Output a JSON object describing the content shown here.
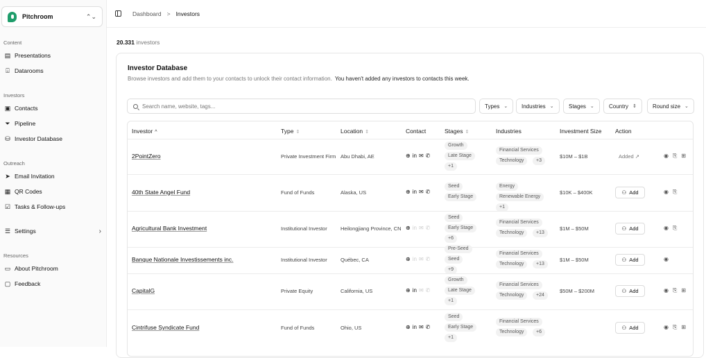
{
  "workspace": {
    "name": "Pitchroom",
    "chevron": "⌃⌄"
  },
  "sidebar": {
    "sections": [
      {
        "label": "Content"
      },
      {
        "label": "Investors"
      },
      {
        "label": "Outreach"
      },
      {
        "label": "Resources"
      }
    ],
    "items": [
      {
        "label": "Presentations",
        "icon": "file-icon"
      },
      {
        "label": "Datarooms",
        "icon": "folder-icon"
      },
      {
        "label": "Contacts",
        "icon": "contact-card-icon"
      },
      {
        "label": "Pipeline",
        "icon": "filter-icon"
      },
      {
        "label": "Investor Database",
        "icon": "database-icon"
      },
      {
        "label": "Email Invitation",
        "icon": "send-icon"
      },
      {
        "label": "QR Codes",
        "icon": "qr-icon"
      },
      {
        "label": "Tasks & Follow-ups",
        "icon": "checkbox-icon"
      },
      {
        "label": "Settings",
        "icon": "sliders-icon",
        "arrow": "›"
      },
      {
        "label": "About Pitchroom",
        "icon": "book-icon"
      },
      {
        "label": "Feedback",
        "icon": "message-icon"
      }
    ]
  },
  "breadcrumb": {
    "root": "Dashboard",
    "sep": ">",
    "current": "Investors"
  },
  "summary": {
    "count": "20.331",
    "suffix": "investors"
  },
  "card": {
    "title": "Investor Database",
    "subtitle": "Browse investors and add them to your contacts to unlock their contact information.",
    "notice": "You haven't added any investors to contacts this week."
  },
  "search": {
    "placeholder": "Search name, website, tags..."
  },
  "filters": [
    {
      "label": "Types",
      "chev": "⌄"
    },
    {
      "label": "Industries",
      "chev": "⌄"
    },
    {
      "label": "Stages",
      "chev": "⌄"
    },
    {
      "label": "Country",
      "chev": "⇕"
    },
    {
      "label": "Round size",
      "chev": "⌄"
    }
  ],
  "columns": [
    {
      "label": "Investor",
      "sort": "^"
    },
    {
      "label": "Type",
      "sort": "⇕"
    },
    {
      "label": "Location",
      "sort": "⇕"
    },
    {
      "label": "Contact",
      "sort": ""
    },
    {
      "label": "Stages",
      "sort": "⇕"
    },
    {
      "label": "Industries",
      "sort": ""
    },
    {
      "label": "Investment Size",
      "sort": ""
    },
    {
      "label": "Action",
      "sort": ""
    }
  ],
  "rows": [
    {
      "name": "2PointZero",
      "type": "Private Investment Firm",
      "location": "Abu Dhabi, AE",
      "stages": [
        "Growth",
        "Late Stage",
        "+1"
      ],
      "industries": [
        "Financial Services",
        "Technology",
        "+3"
      ],
      "size": "$10M – $1B",
      "action": "Added ↗",
      "contact_on": [
        true,
        true,
        true,
        true
      ],
      "acts": [
        "◉",
        "⎘",
        "⊞"
      ]
    },
    {
      "name": "40th State Angel Fund",
      "type": "Fund of Funds",
      "location": "Alaska, US",
      "stages": [
        "Seed",
        "Early Stage"
      ],
      "industries": [
        "Energy",
        "Renewable Energy",
        "+1"
      ],
      "size": "$10K – $400K",
      "action": "Add",
      "contact_on": [
        true,
        true,
        true,
        true
      ],
      "acts": [
        "◉",
        "⎘"
      ]
    },
    {
      "name": "Agricultural Bank Investment",
      "type": "Institutional Investor",
      "location": "Heilongjiang Province, CN",
      "stages": [
        "Seed",
        "Early Stage",
        "+6"
      ],
      "industries": [
        "Financial Services",
        "Technology",
        "+13"
      ],
      "size": "$1M – $50M",
      "action": "Add",
      "contact_on": [
        true,
        false,
        false,
        false
      ],
      "acts": [
        "◉",
        "⎘"
      ]
    },
    {
      "name": "Banque Nationale Investissements inc.",
      "type": "Institutional Investor",
      "location": "Québec, CA",
      "stages": [
        "Pre-Seed",
        "Seed",
        "+9"
      ],
      "industries": [
        "Financial Services",
        "Technology",
        "+13"
      ],
      "size": "$1M – $50M",
      "action": "Add",
      "contact_on": [
        true,
        false,
        false,
        false
      ],
      "acts": [
        "◉"
      ]
    },
    {
      "name": "CapitalG",
      "type": "Private Equity",
      "location": "California, US",
      "stages": [
        "Growth",
        "Late Stage",
        "+1"
      ],
      "industries": [
        "Financial Services",
        "Technology",
        "+24"
      ],
      "size": "$50M – $200M",
      "action": "Add",
      "contact_on": [
        true,
        true,
        false,
        false
      ],
      "acts": [
        "◉",
        "⎘",
        "⊞"
      ]
    },
    {
      "name": "Cintrifuse Syndicate Fund",
      "type": "Fund of Funds",
      "location": "Ohio, US",
      "stages": [
        "Seed",
        "Early Stage",
        "+1"
      ],
      "industries": [
        "Financial Services",
        "Technology",
        "+6"
      ],
      "size": "",
      "action": "Add",
      "contact_on": [
        true,
        true,
        true,
        true
      ],
      "acts": [
        "◉",
        "⎘",
        "⊞"
      ]
    }
  ],
  "contact_icons": [
    "⊕",
    "in",
    "✉",
    "✆"
  ]
}
